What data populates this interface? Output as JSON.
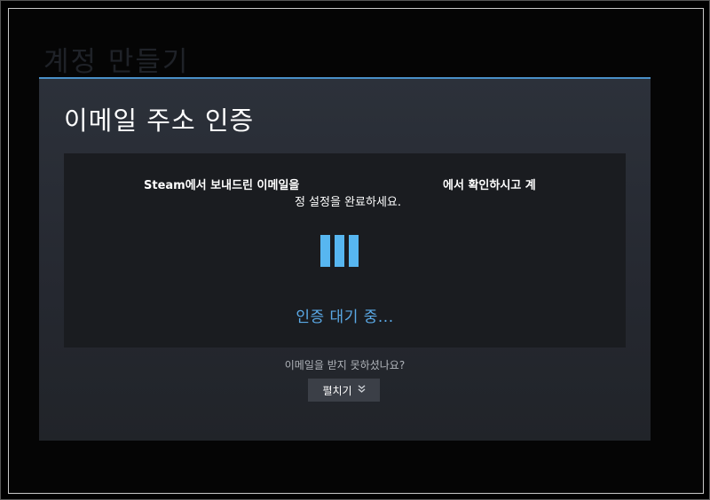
{
  "background": {
    "title": "계정 만들기"
  },
  "dialog": {
    "title": "이메일 주소 인증",
    "message_part1": "Steam에서 보내드린 이메일을",
    "message_part2": "에서 확인하시고 계",
    "message_line2": "정 설정을 완료하세요.",
    "status": "인증 대기 중...",
    "no_email_prompt": "이메일을 받지 못하셨나요?",
    "expand_label": "펼치기",
    "expand_icon": "chevron-double-down-icon"
  },
  "colors": {
    "accent": "#57b6f0",
    "status_text": "#5aa9e6",
    "dialog_border": "#4a90c8"
  }
}
